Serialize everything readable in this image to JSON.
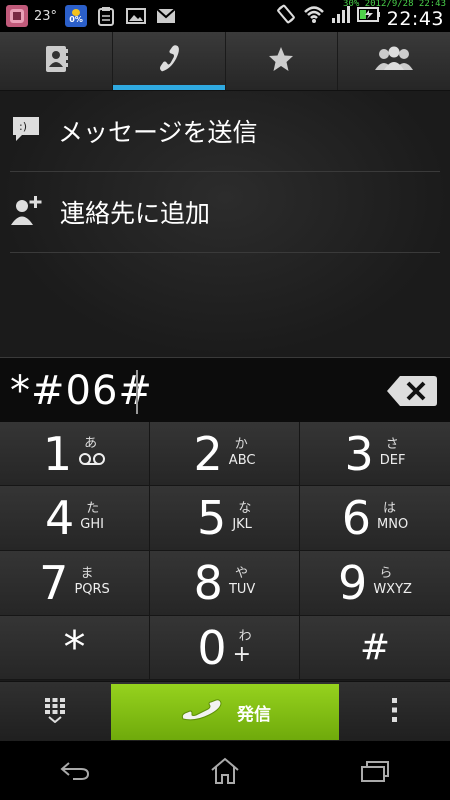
{
  "status_bar": {
    "temperature": "23°",
    "battery_icon_text": "0%",
    "clock": "22:43",
    "overlay": "30% 2012/9/28 22:43",
    "icons": [
      "app-icon",
      "temperature-icon",
      "battery-widget-icon",
      "clipboard-icon",
      "gallery-icon",
      "gmail-icon",
      "rotate-icon",
      "wifi-icon",
      "signal-icon",
      "battery-icon"
    ]
  },
  "tabs": [
    {
      "name": "contacts-tab",
      "icon": "contacts-book-icon"
    },
    {
      "name": "phone-tab",
      "icon": "phone-handset-icon",
      "active": true
    },
    {
      "name": "favorites-tab",
      "icon": "star-icon"
    },
    {
      "name": "groups-tab",
      "icon": "group-icon"
    }
  ],
  "actions": [
    {
      "label": "メッセージを送信",
      "icon": "message-icon"
    },
    {
      "label": "連絡先に追加",
      "icon": "add-contact-icon"
    }
  ],
  "entry": {
    "number": "*#06#"
  },
  "keypad": [
    {
      "digit": "1",
      "kana": "あ",
      "letters": "",
      "voicemail": true
    },
    {
      "digit": "2",
      "kana": "か",
      "letters": "ABC"
    },
    {
      "digit": "3",
      "kana": "さ",
      "letters": "DEF"
    },
    {
      "digit": "4",
      "kana": "た",
      "letters": "GHI"
    },
    {
      "digit": "5",
      "kana": "な",
      "letters": "JKL"
    },
    {
      "digit": "6",
      "kana": "は",
      "letters": "MNO"
    },
    {
      "digit": "7",
      "kana": "ま",
      "letters": "PQRS"
    },
    {
      "digit": "8",
      "kana": "や",
      "letters": "TUV"
    },
    {
      "digit": "9",
      "kana": "ら",
      "letters": "WXYZ"
    },
    {
      "digit": "*",
      "kana": "",
      "letters": ""
    },
    {
      "digit": "0",
      "kana": "わ",
      "letters": "+"
    },
    {
      "digit": "#",
      "kana": "",
      "letters": ""
    }
  ],
  "call_button": {
    "label": "発信"
  },
  "colors": {
    "accent_blue": "#2fa9e0",
    "call_green": "#86c418"
  }
}
